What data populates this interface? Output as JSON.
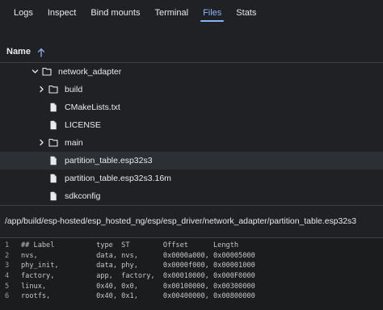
{
  "tabs": [
    {
      "label": "Logs",
      "active": false
    },
    {
      "label": "Inspect",
      "active": false
    },
    {
      "label": "Bind mounts",
      "active": false
    },
    {
      "label": "Terminal",
      "active": false
    },
    {
      "label": "Files",
      "active": true
    },
    {
      "label": "Stats",
      "active": false
    }
  ],
  "tree_header": {
    "label": "Name",
    "sort": "ascending"
  },
  "tree": [
    {
      "label": "network_adapter",
      "type": "folder",
      "expanded": true,
      "depth": 0,
      "selected": false
    },
    {
      "label": "build",
      "type": "folder",
      "expanded": false,
      "depth": 1,
      "selected": false
    },
    {
      "label": "CMakeLists.txt",
      "type": "file",
      "depth": 1,
      "selected": false
    },
    {
      "label": "LICENSE",
      "type": "file",
      "depth": 1,
      "selected": false
    },
    {
      "label": "main",
      "type": "folder",
      "expanded": false,
      "depth": 1,
      "selected": false
    },
    {
      "label": "partition_table.esp32s3",
      "type": "file",
      "depth": 1,
      "selected": true
    },
    {
      "label": "partition_table.esp32s3.16m",
      "type": "file",
      "depth": 1,
      "selected": false
    },
    {
      "label": "sdkconfig",
      "type": "file",
      "depth": 1,
      "selected": false
    }
  ],
  "path": "/app/build/esp-hosted/esp_hosted_ng/esp/esp_driver/network_adapter/partition_table.esp32s3",
  "code_lines": [
    {
      "ln": "1",
      "text": "## Label          type  ST        Offset      Length"
    },
    {
      "ln": "2",
      "text": "nvs,              data, nvs,      0x0000a000, 0x00005000"
    },
    {
      "ln": "3",
      "text": "phy_init,         data, phy,      0x0000f000, 0x00001000"
    },
    {
      "ln": "4",
      "text": "factory,          app,  factory,  0x00010000, 0x000F0000"
    },
    {
      "ln": "5",
      "text": "linux,            0x40, 0x0,      0x00100000, 0x00300000"
    },
    {
      "ln": "6",
      "text": "rootfs,           0x40, 0x1,      0x00400000, 0x00800000"
    }
  ],
  "colors": {
    "accent": "#8ab4f8",
    "background": "#202124",
    "code_background": "#1b1c1e"
  }
}
